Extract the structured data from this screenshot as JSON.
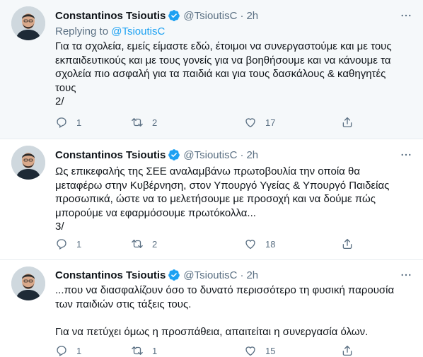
{
  "tweets": [
    {
      "author": {
        "name": "Constantinos Tsioutis",
        "handle": "@TsioutisC",
        "time": "2h"
      },
      "replying": {
        "prefix": "Replying to ",
        "mention": "@TsioutisC"
      },
      "lines": [
        "Για τα σχολεία, εμείς είμαστε εδώ, έτοιμοι να συνεργαστούμε και με τους",
        "εκπαιδευτικούς και με τους γονείς για να βοηθήσουμε και να κάνουμε τα",
        "σχολεία πιο ασφαλή για τα παιδιά και για τους δασκάλους & καθηγητές",
        "τους",
        "2/"
      ],
      "stats": {
        "replies": "1",
        "retweets": "2",
        "likes": "17"
      }
    },
    {
      "author": {
        "name": "Constantinos Tsioutis",
        "handle": "@TsioutisC",
        "time": "2h"
      },
      "lines": [
        "Ως επικεφαλής της ΣΕΕ αναλαμβάνω πρωτοβουλία την οποία θα",
        "μεταφέρω στην Κυβέρνηση, στον Υπουργό Υγείας & Υπουργό Παιδείας",
        "προσωπικά, ώστε να το μελετήσουμε με προσοχή και να δούμε πώς",
        "μπορούμε να εφαρμόσουμε πρωτόκολλα...",
        "3/"
      ],
      "stats": {
        "replies": "1",
        "retweets": "2",
        "likes": "18"
      }
    },
    {
      "author": {
        "name": "Constantinos Tsioutis",
        "handle": "@TsioutisC",
        "time": "2h"
      },
      "lines": [
        "...που να διασφαλίζουν όσο το δυνατό περισσότερο τη φυσική παρουσία",
        "των παιδιών στις τάξεις τους.",
        "",
        "Για να πετύχει όμως η προσπάθεια, απαιτείται η συνεργασία όλων."
      ],
      "stats": {
        "replies": "1",
        "retweets": "1",
        "likes": "15"
      }
    }
  ],
  "icons": {
    "verified": "verified-badge-icon",
    "more": "more-options-icon",
    "reply": "reply-icon",
    "retweet": "retweet-icon",
    "like": "heart-icon",
    "share": "share-icon"
  },
  "colors": {
    "background_highlight": "#f5f8fa",
    "text": "#0f1419",
    "muted": "#5b7083",
    "link": "#1da1f2",
    "verified": "#1da1f2",
    "border": "#e6ecf0"
  }
}
